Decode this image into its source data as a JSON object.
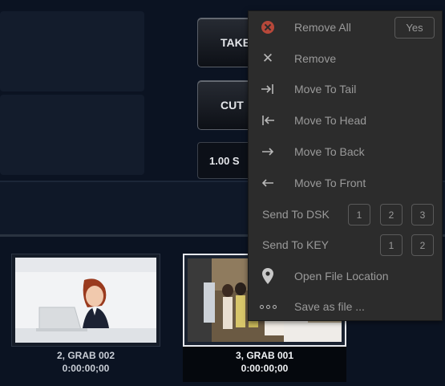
{
  "controls": {
    "take_label": "TAKE",
    "cut_label": "CUT",
    "duration_label": "1.00 S"
  },
  "media": [
    {
      "title": "2, GRAB 002",
      "timecode": "0:00:00;00"
    },
    {
      "title": "3, GRAB 001",
      "timecode": "0:00:00;00"
    }
  ],
  "menu": {
    "remove_all": {
      "label": "Remove All",
      "confirm": "Yes"
    },
    "remove": "Remove",
    "move_to_tail": "Move To Tail",
    "move_to_head": "Move To Head",
    "move_to_back": "Move To Back",
    "move_to_front": "Move To Front",
    "send_to_dsk": {
      "label": "Send To DSK",
      "options": [
        "1",
        "2",
        "3"
      ]
    },
    "send_to_key": {
      "label": "Send To KEY",
      "options": [
        "1",
        "2"
      ]
    },
    "open_file_location": "Open File Location",
    "save_as_file": "Save as file ..."
  },
  "icons": {
    "remove_all": "remove-all-icon",
    "remove": "close-icon",
    "tail": "arrow-to-end-icon",
    "head": "arrow-to-start-icon",
    "back": "arrow-right-icon",
    "front": "arrow-left-icon",
    "location": "map-pin-icon",
    "save": "more-dots-icon"
  },
  "colors": {
    "background": "#0b1322",
    "menu_bg": "#2c2c2c",
    "danger": "#b7483a"
  }
}
